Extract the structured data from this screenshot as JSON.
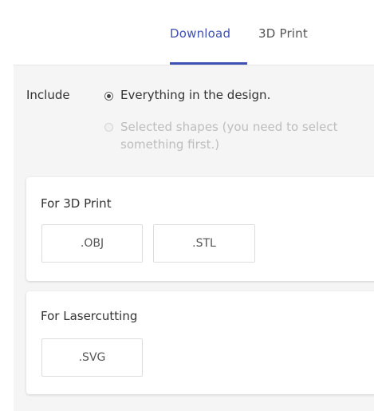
{
  "tabs": [
    {
      "label": "Download",
      "active": true
    },
    {
      "label": "3D Print",
      "active": false
    }
  ],
  "include": {
    "label": "Include",
    "options": [
      {
        "label": "Everything in the design.",
        "selected": true,
        "disabled": false
      },
      {
        "label": "Selected shapes (you need to select something first.)",
        "selected": false,
        "disabled": true
      }
    ]
  },
  "sections": [
    {
      "title": "For 3D Print",
      "buttons": [
        ".OBJ",
        ".STL"
      ]
    },
    {
      "title": "For Lasercutting",
      "buttons": [
        ".SVG"
      ]
    }
  ],
  "colors": {
    "accent": "#3f51b5",
    "panel_background": "#f5f5f5",
    "disabled_text": "#bdbdbd"
  }
}
